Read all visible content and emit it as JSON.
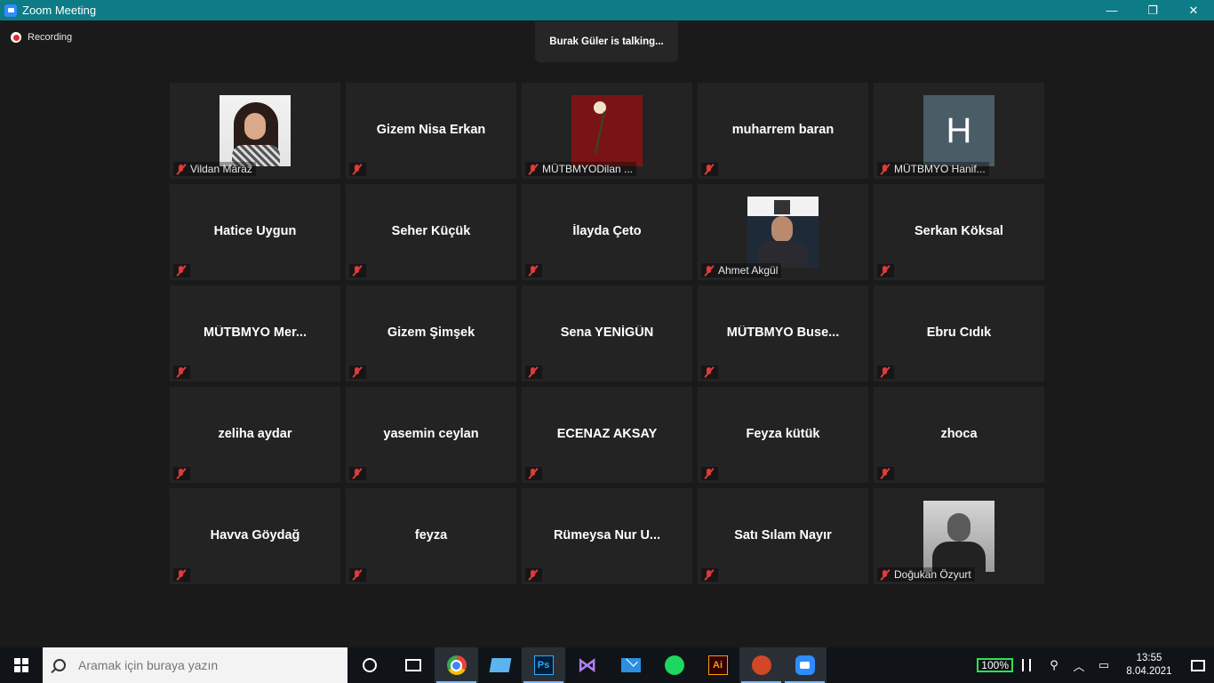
{
  "window": {
    "title": "Zoom Meeting",
    "minimize": "—",
    "restore": "❐",
    "close": "✕"
  },
  "meeting": {
    "recording_label": "Recording",
    "talking": "Burak Güler is talking..."
  },
  "tiles": [
    {
      "name": "",
      "label": "Vildan Maraz",
      "photo": "woman"
    },
    {
      "name": "Gizem Nisa Erkan",
      "label": ""
    },
    {
      "name": "",
      "label": "MÜTBMYODilan ...",
      "photo": "rose"
    },
    {
      "name": "muharrem baran",
      "label": ""
    },
    {
      "name": "",
      "label": "MÜTBMYO Hanif...",
      "avatar": "H"
    },
    {
      "name": "Hatice Uygun",
      "label": ""
    },
    {
      "name": "Seher Küçük",
      "label": ""
    },
    {
      "name": "İlayda Çeto",
      "label": ""
    },
    {
      "name": "",
      "label": "Ahmet Akgül",
      "photo": "man"
    },
    {
      "name": "Serkan Köksal",
      "label": ""
    },
    {
      "name": "MÜTBMYO  Mer...",
      "label": ""
    },
    {
      "name": "Gizem Şimşek",
      "label": ""
    },
    {
      "name": "Sena YENİGÜN",
      "label": ""
    },
    {
      "name": "MÜTBMYO  Buse...",
      "label": ""
    },
    {
      "name": "Ebru Cıdık",
      "label": ""
    },
    {
      "name": "zeliha aydar",
      "label": ""
    },
    {
      "name": "yasemin ceylan",
      "label": ""
    },
    {
      "name": "ECENAZ AKSAY",
      "label": ""
    },
    {
      "name": "Feyza kütük",
      "label": ""
    },
    {
      "name": "zhoca",
      "label": ""
    },
    {
      "name": "Havva Göydağ",
      "label": ""
    },
    {
      "name": "feyza",
      "label": ""
    },
    {
      "name": "Rümeysa Nur U...",
      "label": ""
    },
    {
      "name": "Satı Sılam Nayır",
      "label": ""
    },
    {
      "name": "",
      "label": "Doğukan Özyurt",
      "photo": "bw"
    }
  ],
  "taskbar": {
    "search_placeholder": "Aramak için buraya yazın",
    "apps": [
      "cortana-icon",
      "task-view-icon",
      "chrome-icon",
      "this-pc-icon",
      "photoshop-icon",
      "visual-studio-icon",
      "mail-icon",
      "spotify-icon",
      "illustrator-icon",
      "powerpoint-icon",
      "zoom-icon"
    ],
    "ps_label": "Ps",
    "ai_label": "Ai",
    "battery": "100%",
    "time": "13:55",
    "date": "8.04.2021",
    "accent": "#0e7c86"
  }
}
